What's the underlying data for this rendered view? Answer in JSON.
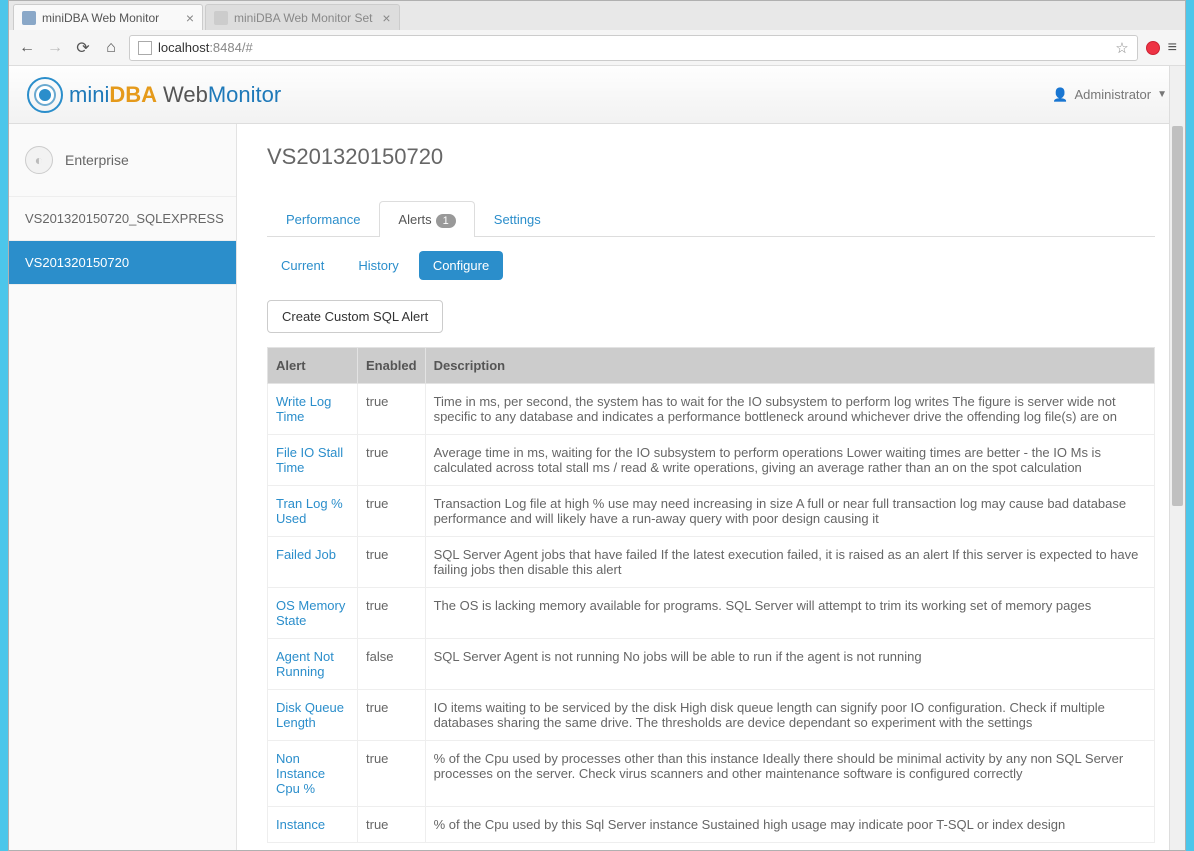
{
  "browser": {
    "tabs": [
      {
        "title": "miniDBA Web Monitor"
      },
      {
        "title": "miniDBA Web Monitor Set"
      }
    ],
    "url_host": "localhost",
    "url_port_path": ":8484/#"
  },
  "header": {
    "logo_p1": "mini",
    "logo_p2": "DBA",
    "logo_p3": "Web",
    "logo_p4": "Monitor",
    "user_label": "Administrator"
  },
  "sidebar": {
    "root": "Enterprise",
    "items": [
      {
        "label": "VS201320150720_SQLEXPRESS",
        "active": false
      },
      {
        "label": "VS201320150720",
        "active": true
      }
    ]
  },
  "page": {
    "title": "VS201320150720",
    "tabs": [
      {
        "label": "Performance"
      },
      {
        "label": "Alerts",
        "badge": "1",
        "active": true
      },
      {
        "label": "Settings"
      }
    ],
    "subtabs": [
      {
        "label": "Current"
      },
      {
        "label": "History"
      },
      {
        "label": "Configure",
        "active": true
      }
    ],
    "create_btn": "Create Custom SQL Alert",
    "columns": {
      "c1": "Alert",
      "c2": "Enabled",
      "c3": "Description"
    },
    "rows": [
      {
        "name": "Write Log Time",
        "enabled": "true",
        "desc": "Time in ms, per second, the system has to wait for the IO subsystem to perform log writes The figure is server wide not specific to any database and indicates a performance bottleneck around whichever drive the offending log file(s) are on"
      },
      {
        "name": "File IO Stall Time",
        "enabled": "true",
        "desc": "Average time in ms, waiting for the IO subsystem to perform operations Lower waiting times are better - the IO Ms is calculated across total stall ms / read & write operations, giving an average rather than an on the spot calculation"
      },
      {
        "name": "Tran Log % Used",
        "enabled": "true",
        "desc": "Transaction Log file at high % use may need increasing in size A full or near full transaction log may cause bad database performance and will likely have a run-away query with poor design causing it"
      },
      {
        "name": "Failed Job",
        "enabled": "true",
        "desc": "SQL Server Agent jobs that have failed If the latest execution failed, it is raised as an alert If this server is expected to have failing jobs then disable this alert"
      },
      {
        "name": "OS Memory State",
        "enabled": "true",
        "desc": "The OS is lacking memory available for programs. SQL Server will attempt to trim its working set of memory pages"
      },
      {
        "name": "Agent Not Running",
        "enabled": "false",
        "desc": "SQL Server Agent is not running No jobs will be able to run if the agent is not running"
      },
      {
        "name": "Disk Queue Length",
        "enabled": "true",
        "desc": "IO items waiting to be serviced by the disk High disk queue length can signify poor IO configuration. Check if multiple databases sharing the same drive. The thresholds are device dependant so experiment with the settings"
      },
      {
        "name": "Non Instance Cpu %",
        "enabled": "true",
        "desc": "% of the Cpu used by processes other than this instance Ideally there should be minimal activity by any non SQL Server processes on the server. Check virus scanners and other maintenance software is configured correctly"
      },
      {
        "name": "Instance",
        "enabled": "true",
        "desc": "% of the Cpu used by this Sql Server instance Sustained high usage may indicate poor T-SQL or index design"
      }
    ]
  }
}
